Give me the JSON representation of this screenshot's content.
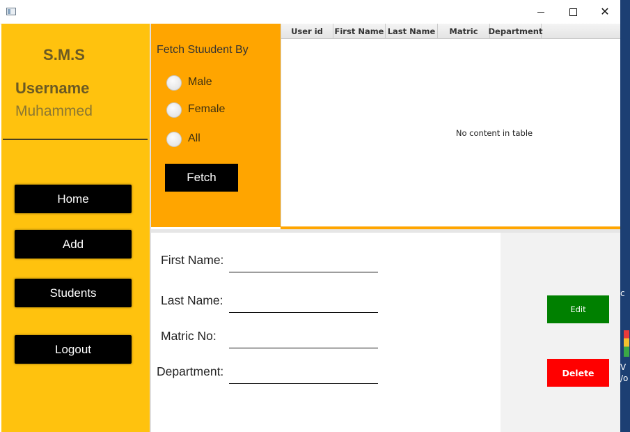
{
  "window": {
    "minimize_icon": "minimize-icon",
    "maximize_icon": "maximize-icon",
    "close_icon": "close-icon",
    "close_glyph": "✕"
  },
  "sidebar": {
    "brand": "S.M.S",
    "username_label": "Username",
    "username_value": "Muhammed",
    "nav": {
      "home": "Home",
      "add": "Add",
      "students": "Students",
      "logout": "Logout"
    }
  },
  "fetch_panel": {
    "title": "Fetch Stuudent By",
    "options": {
      "male": "Male",
      "female": "Female",
      "all": "All"
    },
    "button": "Fetch"
  },
  "table": {
    "columns": [
      "User id",
      "First Name",
      "Last Name",
      "Matric",
      "Department"
    ],
    "rows": [],
    "empty_message": "No content in table"
  },
  "form": {
    "first_name_label": "First Name:",
    "first_name_value": "",
    "last_name_label": "Last Name:",
    "last_name_value": "",
    "matric_label": "Matric No:",
    "matric_value": "",
    "department_label": "Department:",
    "department_value": ""
  },
  "actions": {
    "edit": "Edit",
    "delete": "Delete"
  },
  "desktop_fragments": {
    "a": "c",
    "b": "V",
    "c": "/o"
  },
  "colors": {
    "sidebar": "#ffc20e",
    "fetch_panel": "#ffa500",
    "edit_button": "#008000",
    "delete_button": "#ff0000",
    "nav_button": "#000000"
  }
}
